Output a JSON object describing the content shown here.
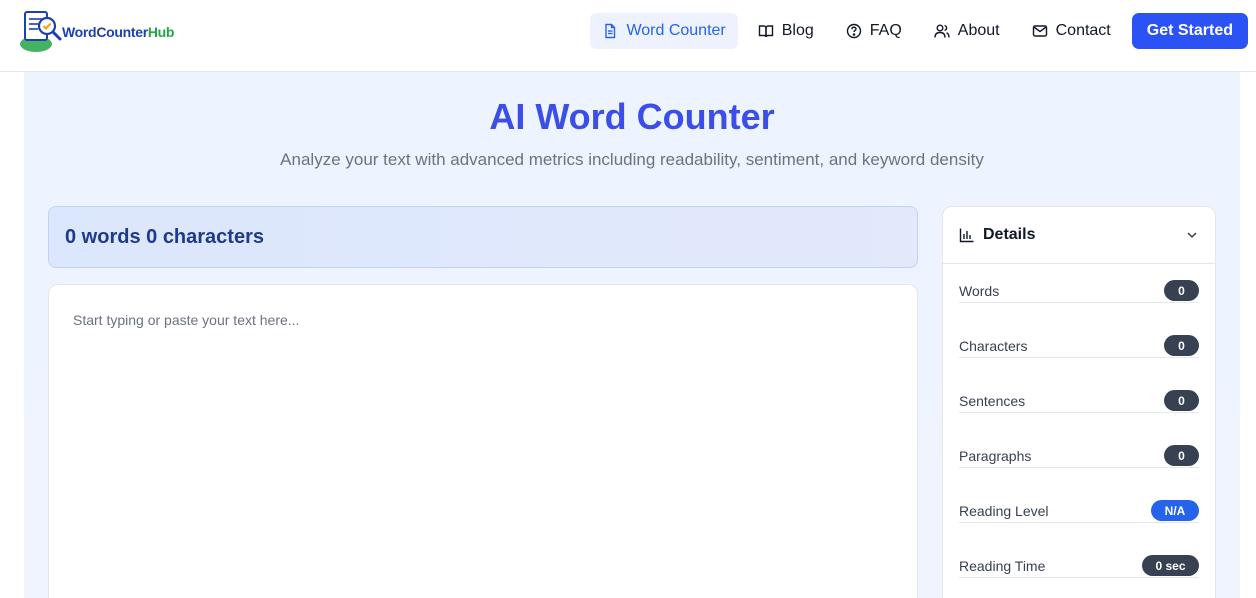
{
  "brand": {
    "name_part1": "WordCounter",
    "name_part2": "Hub"
  },
  "nav": {
    "items": [
      {
        "label": "Word Counter",
        "icon": "document-icon",
        "active": true
      },
      {
        "label": "Blog",
        "icon": "book-icon",
        "active": false
      },
      {
        "label": "FAQ",
        "icon": "question-icon",
        "active": false
      },
      {
        "label": "About",
        "icon": "users-icon",
        "active": false
      },
      {
        "label": "Contact",
        "icon": "mail-icon",
        "active": false
      }
    ],
    "cta_label": "Get Started"
  },
  "hero": {
    "title": "AI Word Counter",
    "subtitle": "Analyze your text with advanced metrics including readability, sentiment, and keyword density"
  },
  "counter": {
    "summary": "0 words 0 characters"
  },
  "editor": {
    "placeholder": "Start typing or paste your text here...",
    "value": ""
  },
  "details": {
    "title": "Details",
    "stats": [
      {
        "label": "Words",
        "value": "0"
      },
      {
        "label": "Characters",
        "value": "0"
      },
      {
        "label": "Sentences",
        "value": "0"
      },
      {
        "label": "Paragraphs",
        "value": "0"
      },
      {
        "label": "Reading Level",
        "value": "N/A"
      },
      {
        "label": "Reading Time",
        "value": "0 sec"
      }
    ]
  },
  "colors": {
    "accent": "#2b52f5",
    "title": "#3b4ee8",
    "badge_dark": "#374151",
    "badge_blue": "#2563eb",
    "brand_green": "#22a447"
  }
}
